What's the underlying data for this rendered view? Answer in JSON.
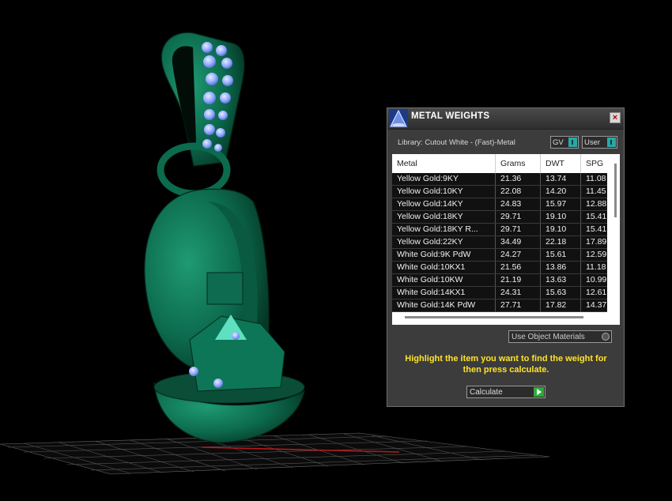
{
  "panel": {
    "title": "METAL WEIGHTS",
    "close_icon": "close-icon",
    "library_label": "Library: Cutout White - (Fast)-Metal",
    "gv_select": "GV",
    "user_select": "User",
    "table": {
      "columns": [
        "Metal",
        "Grams",
        "DWT",
        "SPG"
      ],
      "rows": [
        [
          "Yellow Gold:9KY",
          "21.36",
          "13.74",
          "11.08"
        ],
        [
          "Yellow Gold:10KY",
          "22.08",
          "14.20",
          "11.45"
        ],
        [
          "Yellow Gold:14KY",
          "24.83",
          "15.97",
          "12.88"
        ],
        [
          "Yellow Gold:18KY",
          "29.71",
          "19.10",
          "15.41"
        ],
        [
          "Yellow Gold:18KY R...",
          "29.71",
          "19.10",
          "15.41"
        ],
        [
          "Yellow Gold:22KY",
          "34.49",
          "22.18",
          "17.89"
        ],
        [
          "White Gold:9K PdW",
          "24.27",
          "15.61",
          "12.59"
        ],
        [
          "White Gold:10KX1",
          "21.56",
          "13.86",
          "11.18"
        ],
        [
          "White Gold:10KW",
          "21.19",
          "13.63",
          "10.99"
        ],
        [
          "White Gold:14KX1",
          "24.31",
          "15.63",
          "12.61"
        ],
        [
          "White Gold:14K PdW",
          "27.71",
          "17.82",
          "14.37"
        ]
      ]
    },
    "use_object_materials": "Use Object Materials",
    "instruction": "Highlight the item you want to find the weight for then press calculate.",
    "calculate": "Calculate"
  },
  "colors": {
    "model": "#0e6b4f",
    "gems": "#9fb8ff",
    "instruction": "#ffe326",
    "panel_bg": "#3c3c3c"
  }
}
